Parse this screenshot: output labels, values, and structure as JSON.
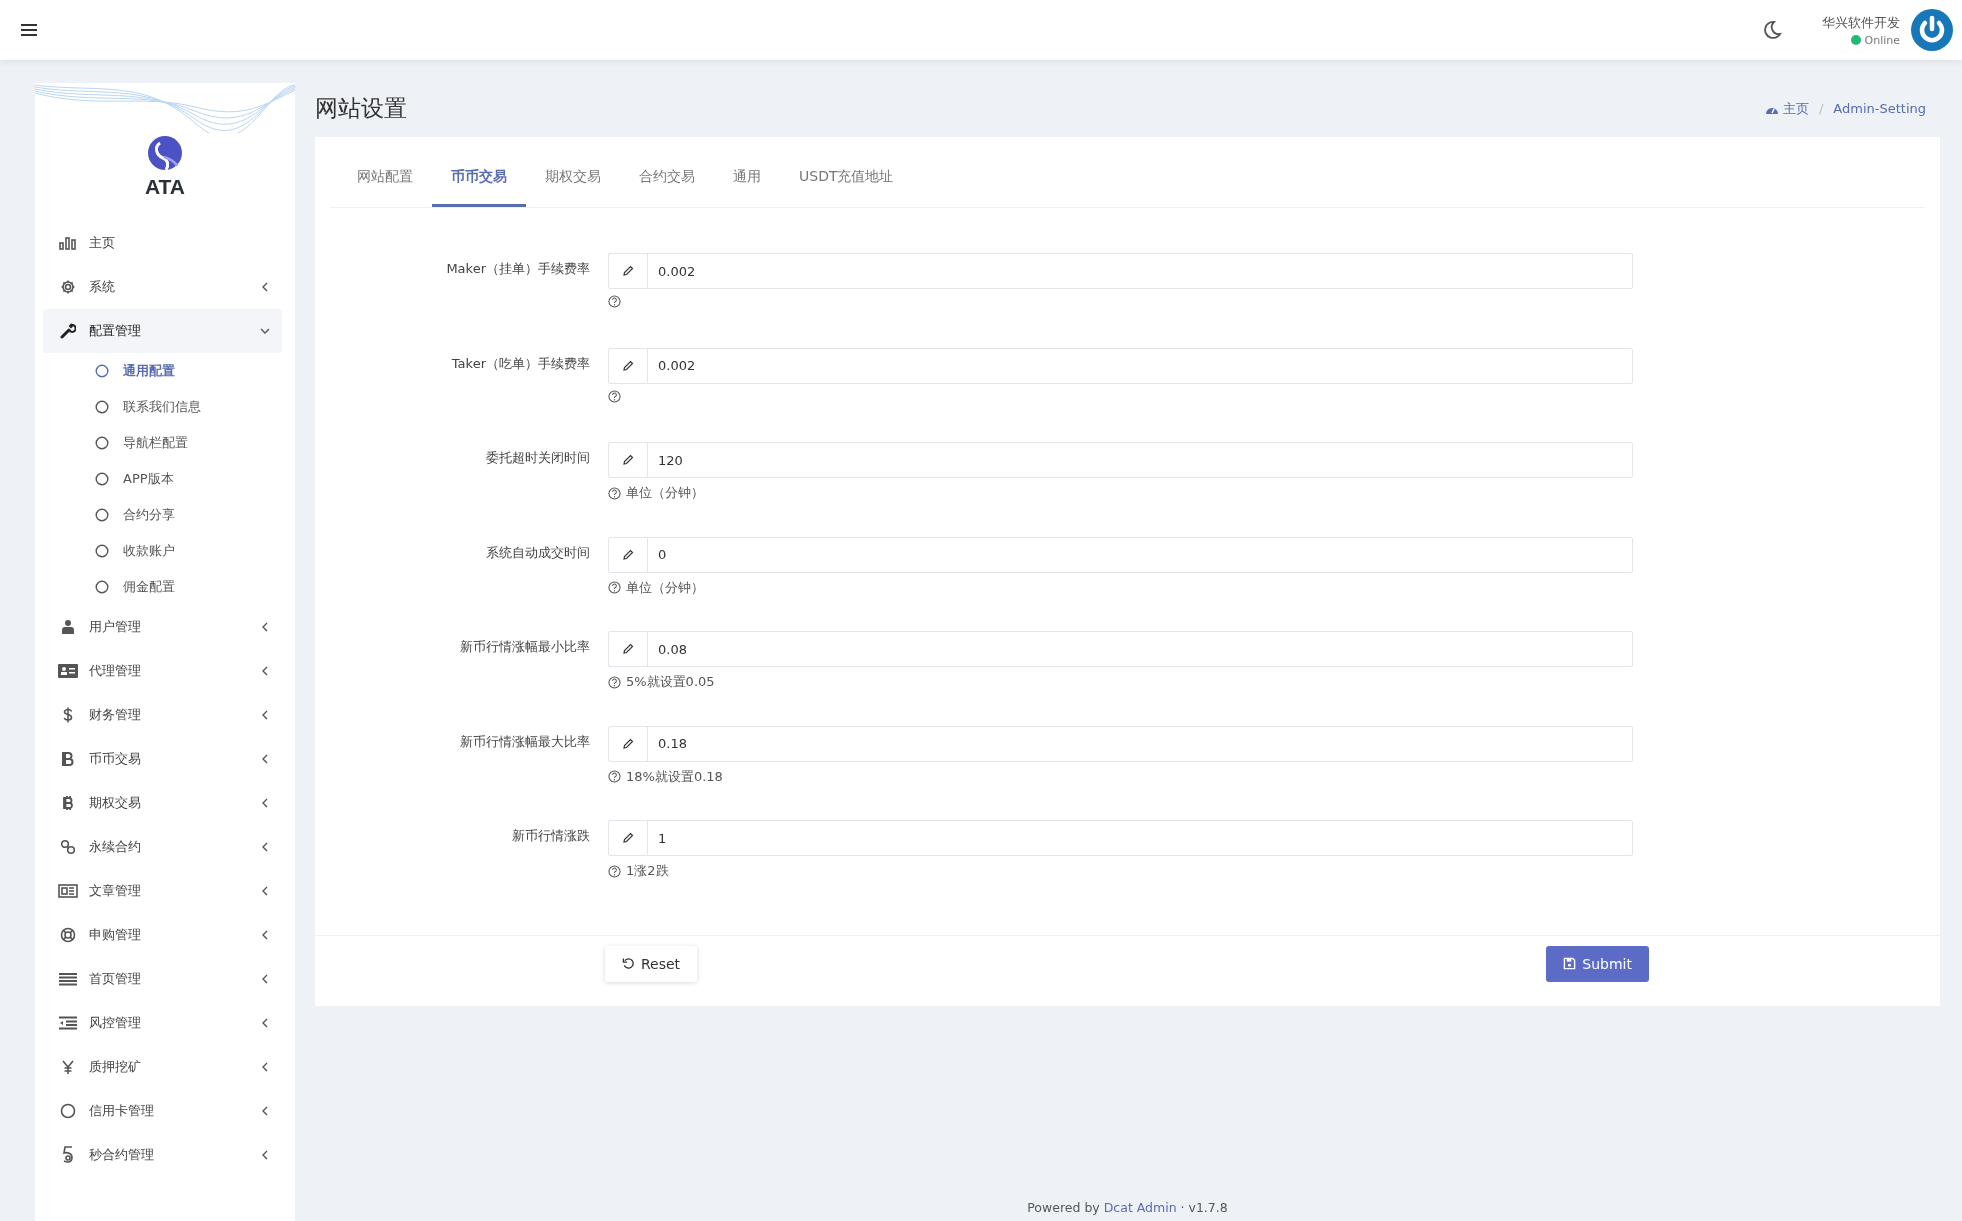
{
  "header": {
    "user": {
      "name": "华兴软件开发",
      "status": "Online",
      "online": true
    }
  },
  "sidebar": {
    "brand": "ATA",
    "items": [
      {
        "label": "主页",
        "has_caret": false,
        "expanded": false
      },
      {
        "label": "系统",
        "has_caret": true,
        "expanded": false
      },
      {
        "label": "配置管理",
        "has_caret": true,
        "expanded": true,
        "children": [
          {
            "label": "通用配置",
            "selected": true
          },
          {
            "label": "联系我们信息",
            "selected": false
          },
          {
            "label": "导航栏配置",
            "selected": false
          },
          {
            "label": "APP版本",
            "selected": false
          },
          {
            "label": "合约分享",
            "selected": false
          },
          {
            "label": "收款账户",
            "selected": false
          },
          {
            "label": "佣金配置",
            "selected": false
          }
        ]
      },
      {
        "label": "用户管理",
        "has_caret": true,
        "expanded": false
      },
      {
        "label": "代理管理",
        "has_caret": true,
        "expanded": false
      },
      {
        "label": "财务管理",
        "has_caret": true,
        "expanded": false
      },
      {
        "label": "币币交易",
        "has_caret": true,
        "expanded": false
      },
      {
        "label": "期权交易",
        "has_caret": true,
        "expanded": false
      },
      {
        "label": "永续合约",
        "has_caret": true,
        "expanded": false
      },
      {
        "label": "文章管理",
        "has_caret": true,
        "expanded": false
      },
      {
        "label": "申购管理",
        "has_caret": true,
        "expanded": false
      },
      {
        "label": "首页管理",
        "has_caret": true,
        "expanded": false
      },
      {
        "label": "风控管理",
        "has_caret": true,
        "expanded": false
      },
      {
        "label": "质押挖矿",
        "has_caret": true,
        "expanded": false
      },
      {
        "label": "信用卡管理",
        "has_caret": true,
        "expanded": false
      },
      {
        "label": "秒合约管理",
        "has_caret": true,
        "expanded": false
      }
    ]
  },
  "page": {
    "title": "网站设置",
    "breadcrumb_separator": "/",
    "breadcrumb": [
      {
        "label": "主页"
      },
      {
        "label": "Admin-Setting"
      }
    ]
  },
  "tabs": [
    {
      "label": "网站配置",
      "selected": false
    },
    {
      "label": "币币交易",
      "selected": true
    },
    {
      "label": "期权交易",
      "selected": false
    },
    {
      "label": "合约交易",
      "selected": false
    },
    {
      "label": "通用",
      "selected": false
    },
    {
      "label": "USDT充值地址",
      "selected": false
    }
  ],
  "form": {
    "fields": [
      {
        "label": "Maker（挂单）手续费率",
        "value": "0.002"
      },
      {
        "label": "Taker（吃单）手续费率",
        "value": "0.002"
      },
      {
        "label": "委托超时关闭时间",
        "value": "120",
        "help": "单位（分钟）"
      },
      {
        "label": "系统自动成交时间",
        "value": "0",
        "help": "单位（分钟）"
      },
      {
        "label": "新币行情涨幅最小比率",
        "value": "0.08",
        "help": "5%就设置0.05"
      },
      {
        "label": "新币行情涨幅最大比率",
        "value": "0.18",
        "help": "18%就设置0.18"
      },
      {
        "label": "新币行情涨跌",
        "value": "1",
        "help": "1涨2跌"
      }
    ],
    "buttons": [
      {
        "label": "Reset",
        "kind": "reset"
      },
      {
        "label": "Submit",
        "kind": "submit"
      }
    ]
  },
  "footer": {
    "prefix": "Powered by",
    "link": "Dcat Admin",
    "suffix": "· v1.7.8"
  }
}
